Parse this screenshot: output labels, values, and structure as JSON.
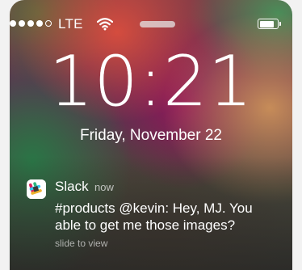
{
  "status_bar": {
    "signal_bars_filled": 4,
    "signal_bars_total": 5,
    "carrier": "LTE",
    "icons": [
      "signal-dots-icon",
      "wifi-icon",
      "battery-icon"
    ],
    "battery_level": 0.85
  },
  "lock_screen": {
    "time": "10:21",
    "date": "Friday, November 22"
  },
  "notification": {
    "app_icon": "slack-icon",
    "app_name": "Slack",
    "timestamp": "now",
    "message": "#products @kevin: Hey, MJ. You able to get me those images?",
    "action_hint": "slide to view"
  },
  "colors": {
    "text": "#ffffff",
    "secondary_text": "#d0d0d0"
  }
}
